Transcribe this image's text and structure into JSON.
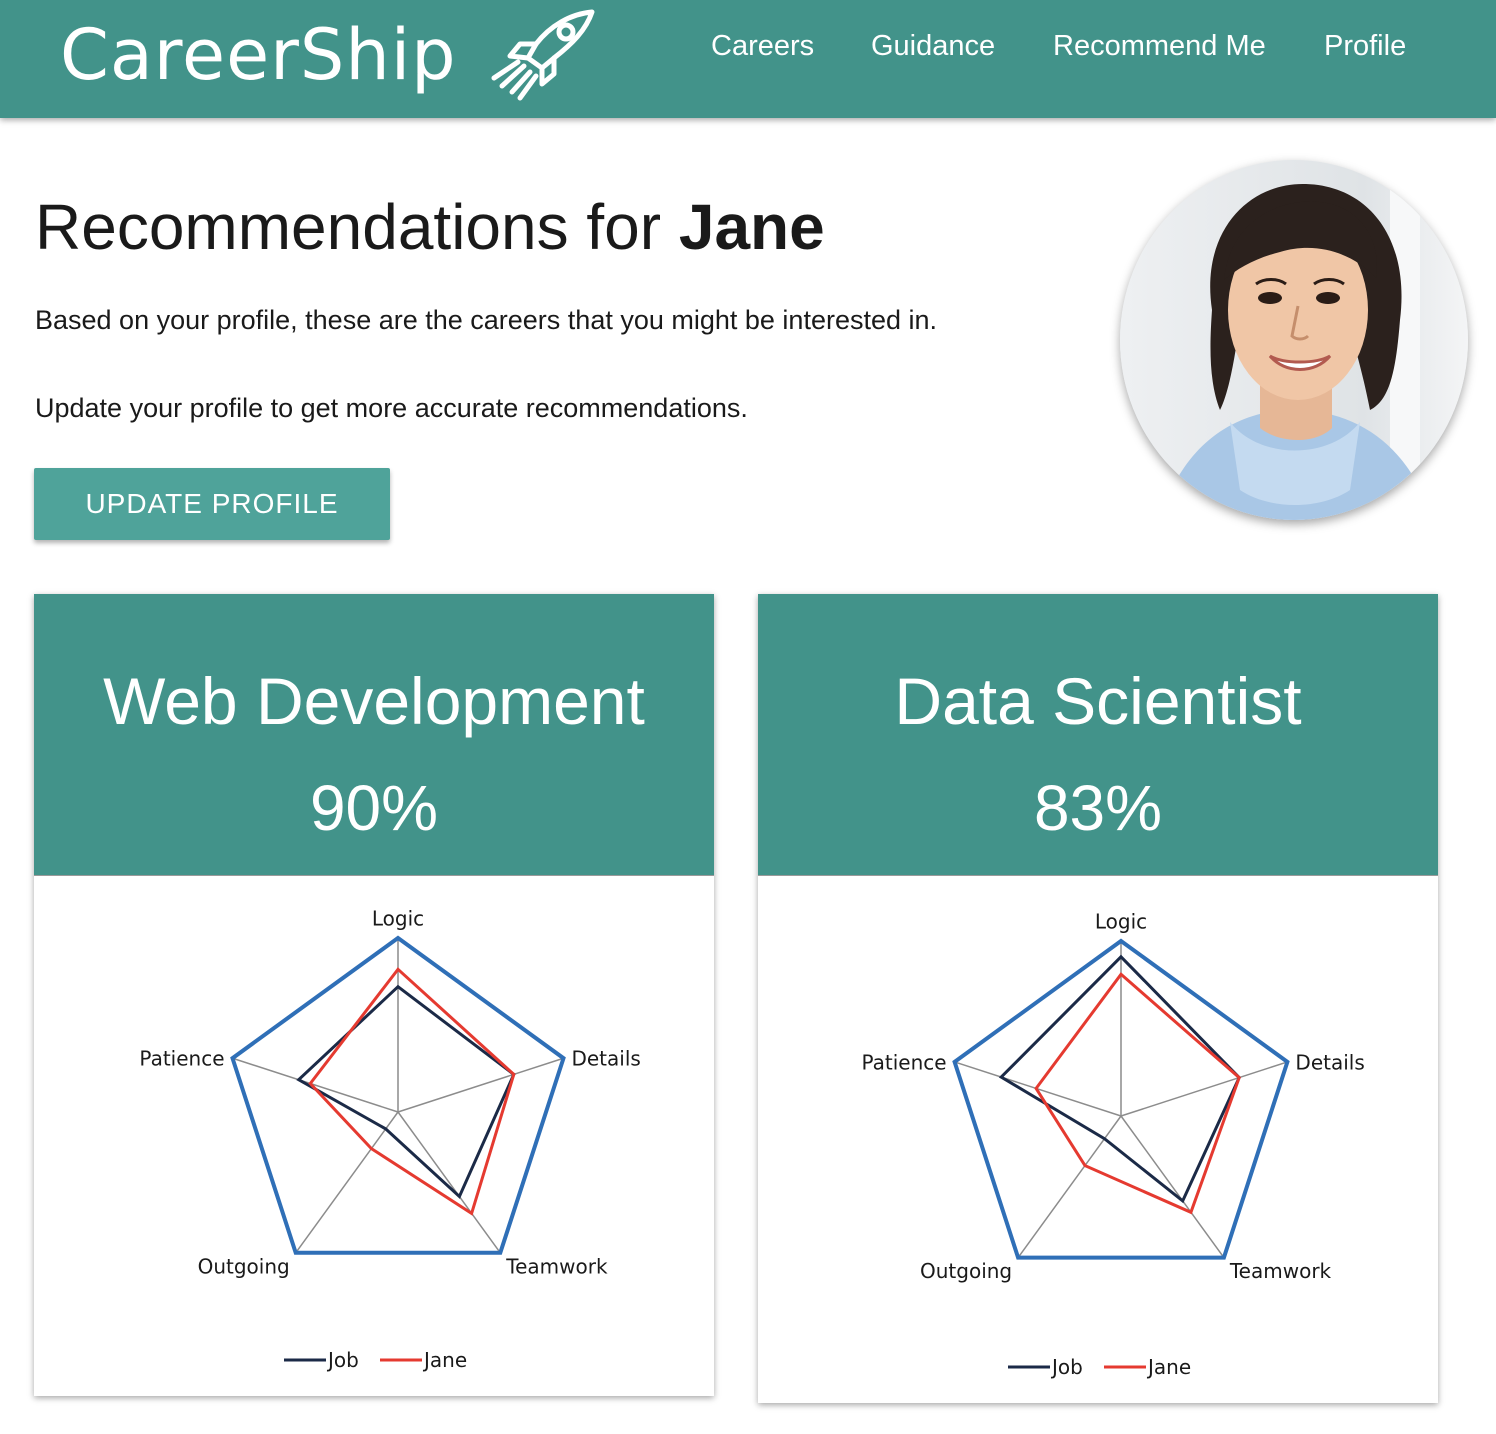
{
  "header": {
    "brand": "CareerShip",
    "nav": [
      {
        "label": "Careers"
      },
      {
        "label": "Guidance"
      },
      {
        "label": "Recommend Me"
      },
      {
        "label": "Profile"
      }
    ],
    "bar_color": "#42938a"
  },
  "main": {
    "title_prefix": "Recommendations for",
    "title_name": "Jane",
    "line1": "Based on your profile, these are the careers that you might be interested in.",
    "line2": "Update your profile to get more accurate recommendations.",
    "update_button": "UPDATE PROFILE"
  },
  "cards": [
    {
      "title": "Web Development",
      "percent": "90%"
    },
    {
      "title": "Data Scientist",
      "percent": "83%"
    }
  ],
  "chart_data": [
    {
      "type": "radar",
      "axes": [
        "Logic",
        "Details",
        "Teamwork",
        "Outgoing",
        "Patience"
      ],
      "max": 1.0,
      "series": [
        {
          "name": "Job",
          "color": "#1b2a47",
          "values": [
            0.72,
            0.7,
            0.6,
            0.12,
            0.6
          ]
        },
        {
          "name": "Jane",
          "color": "#e53a30",
          "values": [
            0.82,
            0.7,
            0.72,
            0.26,
            0.53
          ]
        }
      ],
      "outline_color": "#2f6fb7",
      "legend": [
        "Job",
        "Jane"
      ]
    },
    {
      "type": "radar",
      "axes": [
        "Logic",
        "Details",
        "Teamwork",
        "Outgoing",
        "Patience"
      ],
      "max": 1.0,
      "series": [
        {
          "name": "Job",
          "color": "#1b2a47",
          "values": [
            0.91,
            0.71,
            0.6,
            0.16,
            0.72
          ]
        },
        {
          "name": "Jane",
          "color": "#e53a30",
          "values": [
            0.81,
            0.71,
            0.68,
            0.35,
            0.51
          ]
        }
      ],
      "outline_color": "#2f6fb7",
      "legend": [
        "Job",
        "Jane"
      ]
    }
  ]
}
